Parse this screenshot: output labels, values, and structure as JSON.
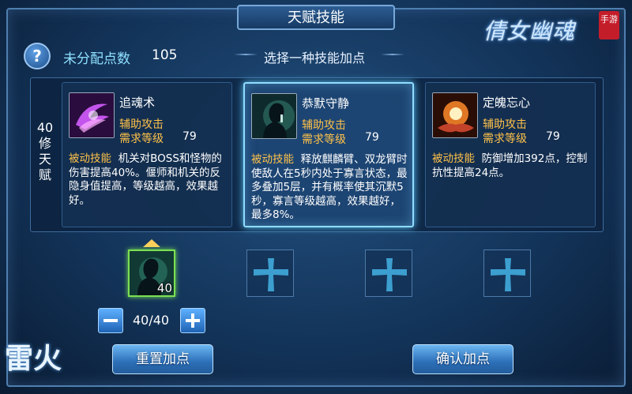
{
  "window": {
    "title": "天赋技能",
    "logo_text": "倩女幽魂",
    "logo_seal": "手游",
    "corner_logo": "雷火"
  },
  "header": {
    "help_icon": "?",
    "points_label": "未分配点数",
    "points_value": "105",
    "hint": "选择一种技能加点"
  },
  "tier": {
    "label": "40修天赋"
  },
  "skills": [
    {
      "name": "追魂术",
      "type": "辅助攻击",
      "req_label": "需求等级",
      "req_value": "79",
      "desc_tag": "被动技能",
      "desc_text": "机关对BOSS和怪物的伤害提高40%。偃师和机关的反隐身值提高，等级越高，效果越好。",
      "icon": "purple-swirl-icon"
    },
    {
      "name": "恭默守静",
      "type": "辅助攻击",
      "req_label": "需求等级",
      "req_value": "79",
      "desc_tag": "被动技能",
      "desc_text": "释放麒麟臂、双龙臂时使敌人在5秒内处于寡言状态，最多叠加5层，并有概率使其沉默5秒，寡言等级越高，效果越好，最多8%。",
      "icon": "silent-figure-icon",
      "selected": true
    },
    {
      "name": "定魄忘心",
      "type": "辅助攻击",
      "req_label": "需求等级",
      "req_value": "79",
      "desc_tag": "被动技能",
      "desc_text": "防御增加392点，控制抗性提高24点。",
      "icon": "fire-hands-icon"
    }
  ],
  "slots": [
    {
      "level": "40",
      "active": true,
      "icon": "silent-figure-icon"
    },
    {
      "icon": "plus-icon"
    },
    {
      "icon": "plus-icon"
    },
    {
      "icon": "plus-icon"
    }
  ],
  "allocation": {
    "counter": "40/40"
  },
  "buttons": {
    "reset": "重置加点",
    "confirm": "确认加点"
  },
  "colors": {
    "accent_cyan": "#8fdcff",
    "gold_text": "#ffc24a",
    "slot_active": "#7be052"
  }
}
